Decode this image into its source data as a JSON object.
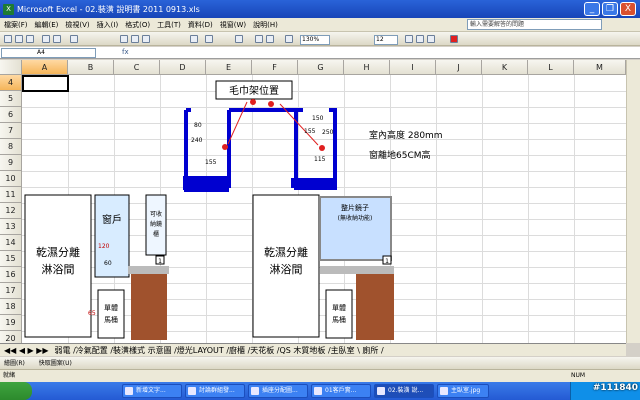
{
  "window": {
    "title": "Microsoft Excel - 02.裝潢 說明書 2011 0913.xls",
    "minimize": "_",
    "restore": "❐",
    "close": "X"
  },
  "menu": [
    "檔案(F)",
    "編輯(E)",
    "檢視(V)",
    "插入(I)",
    "格式(O)",
    "工具(T)",
    "資料(D)",
    "視窗(W)",
    "說明(H)"
  ],
  "help_placeholder": "輸入需要解答的問題",
  "toolbar": {
    "zoom": "130%",
    "font_size": "12"
  },
  "formula": {
    "cell_ref": "A4",
    "fx": "fx"
  },
  "columns": [
    "A",
    "B",
    "C",
    "D",
    "E",
    "F",
    "G",
    "H",
    "I",
    "J",
    "K",
    "L",
    "M"
  ],
  "rows": [
    "4",
    "5",
    "6",
    "7",
    "8",
    "9",
    "10",
    "11",
    "12",
    "13",
    "14",
    "15",
    "16",
    "17",
    "18",
    "19",
    "20"
  ],
  "drawing": {
    "towel_label": "毛巾架位置",
    "dims": {
      "d80": "80",
      "d240": "240",
      "d155": "155",
      "d150": "150",
      "d250": "250",
      "d115": "115",
      "d155b": "155",
      "d120": "120",
      "d60": "60",
      "d65": "65"
    },
    "height_note": [
      "室內高度 280mm",
      "窗離地65CM高"
    ],
    "shower_left": [
      "乾濕分離",
      "淋浴間"
    ],
    "window_label": "窗戶",
    "cabinet_label": [
      "可收",
      "納鏡",
      "櫃"
    ],
    "toilet": [
      "單體",
      "馬桶"
    ],
    "shower_right": [
      "乾濕分離",
      "淋浴間"
    ],
    "mirror": [
      "整片鏡子",
      "(無收納功能)"
    ],
    "toilet_right": [
      "單體",
      "馬桶"
    ],
    "socket": "1"
  },
  "sheet_tabs": "弱電 /冷氣配置 /裝潢樣式 示意圖 /燈光LAYOUT /廚櫃 /天花板 /QS 木質地板 /主臥室 \\ 廁所 /",
  "drawbar": {
    "draw": "繪圖(R)",
    "shapes": "快取圖案(U)"
  },
  "status": {
    "ready": "就緒",
    "num": "NUM"
  },
  "taskbar": [
    "新增文字...",
    "討論群組發...",
    "插座分配圖...",
    "01客戶實...",
    "02.裝潢 說...",
    "主臥室.jpg"
  ],
  "watermark": "#111840"
}
